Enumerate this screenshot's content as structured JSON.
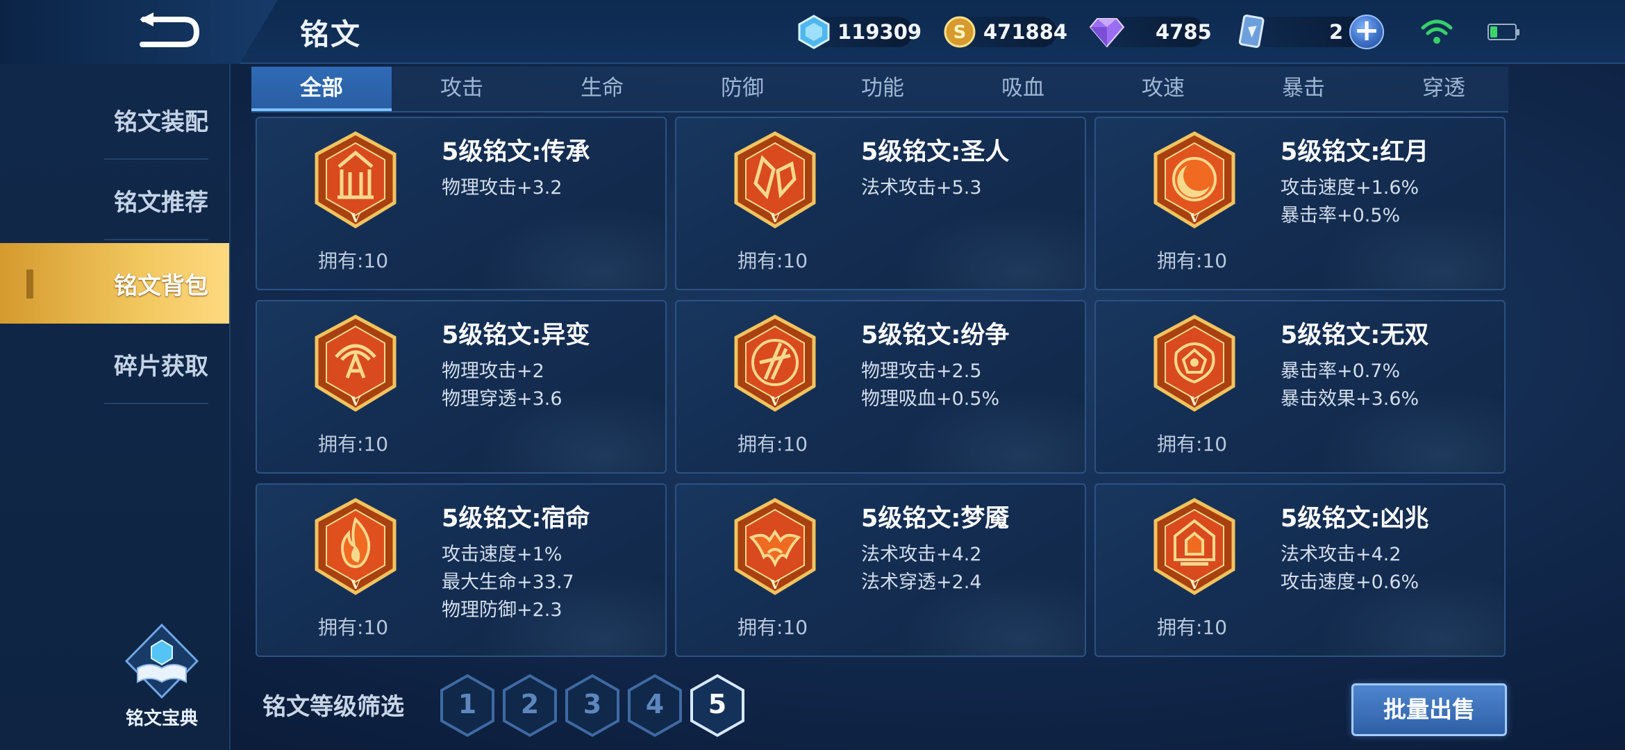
{
  "header": {
    "title": "铭文",
    "currencies": {
      "coupon": "119309",
      "gold": "471884",
      "diamond": "4785",
      "card": "2"
    }
  },
  "sidebar": {
    "items": [
      {
        "label": "铭文装配",
        "active": false
      },
      {
        "label": "铭文推荐",
        "active": false
      },
      {
        "label": "铭文背包",
        "active": true
      },
      {
        "label": "碎片获取",
        "active": false
      }
    ],
    "codex_label": "铭文宝典"
  },
  "tabs": [
    {
      "label": "全部",
      "active": true
    },
    {
      "label": "攻击"
    },
    {
      "label": "生命"
    },
    {
      "label": "防御"
    },
    {
      "label": "功能"
    },
    {
      "label": "吸血"
    },
    {
      "label": "攻速"
    },
    {
      "label": "暴击"
    },
    {
      "label": "穿透"
    }
  ],
  "inscriptions": [
    {
      "name": "5级铭文:传承",
      "attrs": [
        "物理攻击+3.2"
      ],
      "owned": "拥有:10",
      "level_glyph": "V",
      "icon": "tower-emblem-icon"
    },
    {
      "name": "5级铭文:圣人",
      "attrs": [
        "法术攻击+5.3"
      ],
      "owned": "拥有:10",
      "level_glyph": "V",
      "icon": "crystal-emblem-icon"
    },
    {
      "name": "5级铭文:红月",
      "attrs": [
        "攻击速度+1.6%",
        "暴击率+0.5%"
      ],
      "owned": "拥有:10",
      "level_glyph": "V",
      "icon": "moon-emblem-icon"
    },
    {
      "name": "5级铭文:异变",
      "attrs": [
        "物理攻击+2",
        "物理穿透+3.6"
      ],
      "owned": "拥有:10",
      "level_glyph": "V",
      "icon": "arch-emblem-icon"
    },
    {
      "name": "5级铭文:纷争",
      "attrs": [
        "物理攻击+2.5",
        "物理吸血+0.5%"
      ],
      "owned": "拥有:10",
      "level_glyph": "V",
      "icon": "claw-emblem-icon"
    },
    {
      "name": "5级铭文:无双",
      "attrs": [
        "暴击率+0.7%",
        "暴击效果+3.6%"
      ],
      "owned": "拥有:10",
      "level_glyph": "V",
      "icon": "vortex-emblem-icon"
    },
    {
      "name": "5级铭文:宿命",
      "attrs": [
        "攻击速度+1%",
        "最大生命+33.7",
        "物理防御+2.3"
      ],
      "owned": "拥有:10",
      "level_glyph": "V",
      "icon": "flame-emblem-icon"
    },
    {
      "name": "5级铭文:梦魇",
      "attrs": [
        "法术攻击+4.2",
        "法术穿透+2.4"
      ],
      "owned": "拥有:10",
      "level_glyph": "V",
      "icon": "bat-emblem-icon"
    },
    {
      "name": "5级铭文:凶兆",
      "attrs": [
        "法术攻击+4.2",
        "攻击速度+0.6%"
      ],
      "owned": "拥有:10",
      "level_glyph": "V",
      "icon": "lantern-emblem-icon"
    }
  ],
  "filter": {
    "label": "铭文等级筛选",
    "levels": [
      "1",
      "2",
      "3",
      "4",
      "5"
    ],
    "selected": "5"
  },
  "actions": {
    "bulk_sell": "批量出售"
  },
  "colors": {
    "active_sidebar": "#f0c65d",
    "active_tab": "#2f6bb5",
    "emblem_red": "#d94a1f",
    "emblem_gold": "#f2c35e",
    "status_green": "#3cd46a"
  }
}
